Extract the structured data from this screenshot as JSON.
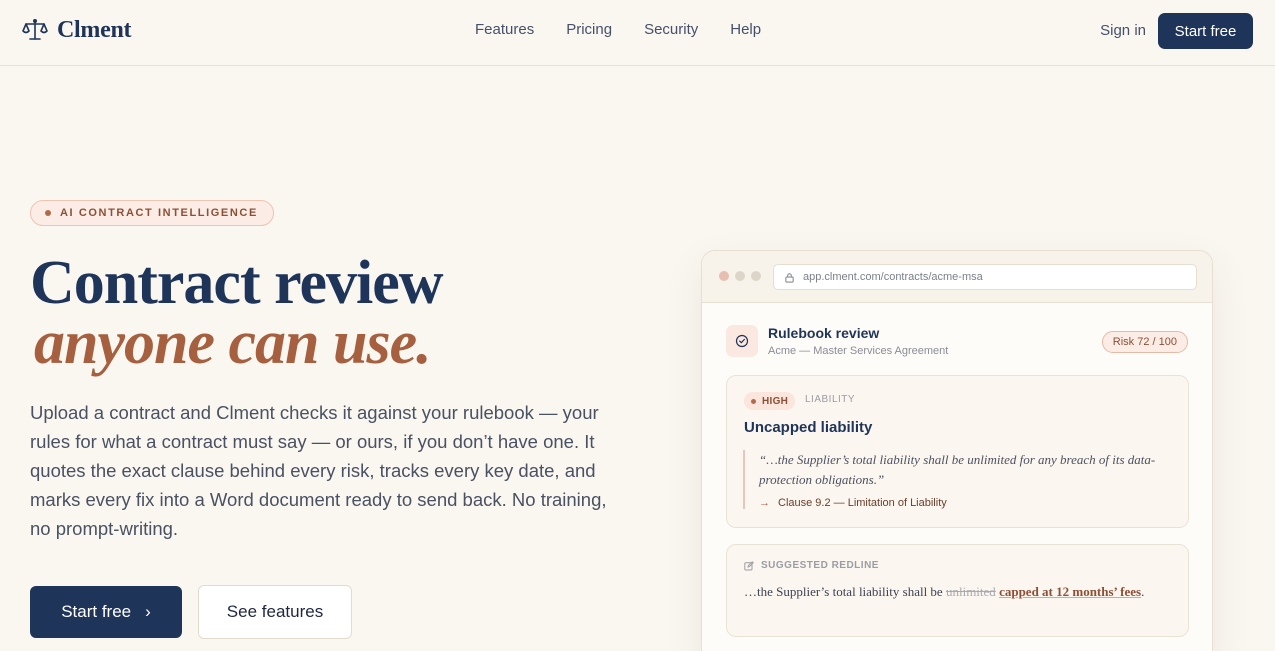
{
  "nav": {
    "brand": "Clment",
    "links": [
      "Features",
      "Pricing",
      "Security",
      "Help"
    ],
    "sign_in": "Sign in",
    "cta": "Start free"
  },
  "hero": {
    "eyebrow": "AI CONTRACT INTELLIGENCE",
    "headline_line1": "Contract review",
    "headline_line2": "anyone can use.",
    "lead": "Upload a contract and Clment checks it against your rulebook — your rules for what a contract must say — or ours, if you don’t have one. It quotes the exact clause behind every risk, tracks every key date, and marks every fix into a Word document ready to send back. No training, no prompt-writing.",
    "primary_cta": "Start free",
    "secondary_cta": "See features"
  },
  "app_preview": {
    "url": "app.clment.com/contracts/acme-msa",
    "panel_title": "Rulebook review",
    "panel_subtitle": "Acme — Master Services Agreement",
    "risk_badge": "Risk 72 / 100",
    "finding": {
      "severity": "HIGH",
      "category": "LIABILITY",
      "title": "Uncapped liability",
      "quote": "“…the Supplier’s total liability shall be unlimited for any breach of its data-protection obligations.”",
      "citation": "Clause 9.2 — Limitation of Liability"
    },
    "redline": {
      "label": "SUGGESTED REDLINE",
      "prefix": "…the Supplier’s total liability shall be",
      "deleted": "unlimited",
      "inserted": "capped at 12 months’ fees",
      "suffix": "."
    }
  },
  "colors": {
    "navy": "#1F3459",
    "terracotta": "#A6603F",
    "background": "#FAF7F1"
  }
}
